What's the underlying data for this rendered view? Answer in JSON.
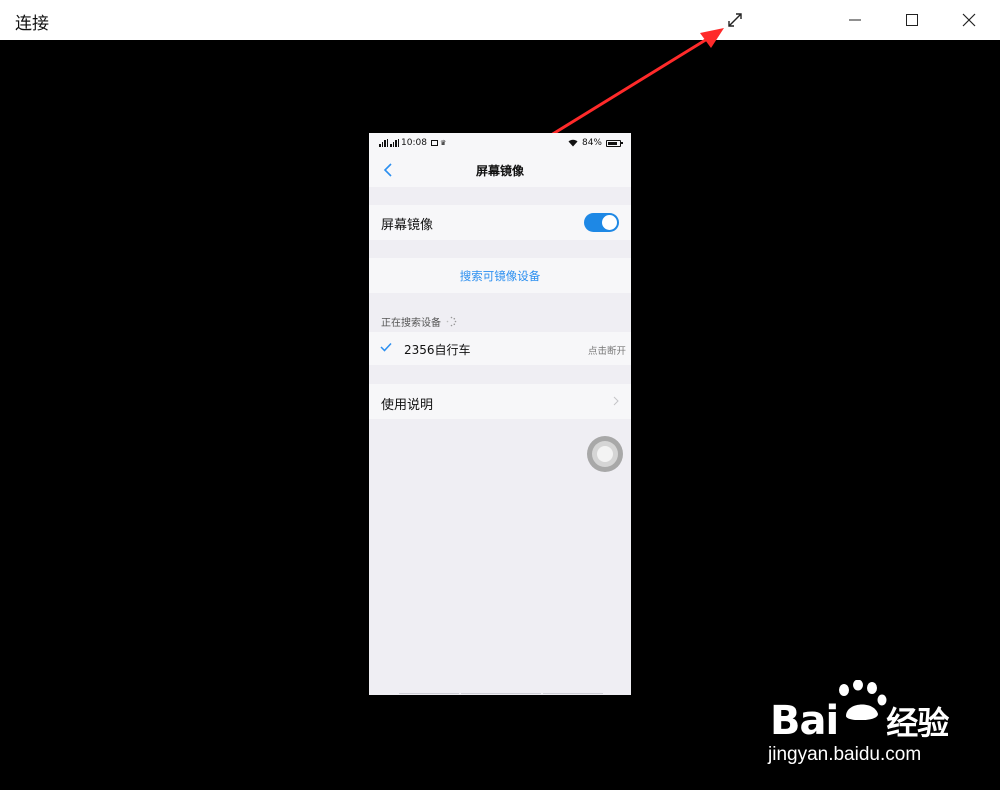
{
  "window": {
    "title": "连接"
  },
  "phone": {
    "status_bar": {
      "time": "10:08",
      "battery": "84%"
    },
    "nav": {
      "title": "屏幕镜像"
    },
    "mirror_row": {
      "label": "屏幕镜像",
      "toggle_on": true
    },
    "search_link": "搜索可镜像设备",
    "section_label": "正在搜索设备",
    "device": {
      "name": "2356自行车",
      "action": "点击断开"
    },
    "guide_row": {
      "label": "使用说明"
    }
  },
  "watermark": {
    "logo_text": "Bai",
    "logo_suffix": "经验",
    "site": "jingyan.baidu.com"
  },
  "colors": {
    "accent": "#1e88e5",
    "link": "#2b8ff0",
    "annotation": "#ff2a2a",
    "background": "#000000"
  }
}
